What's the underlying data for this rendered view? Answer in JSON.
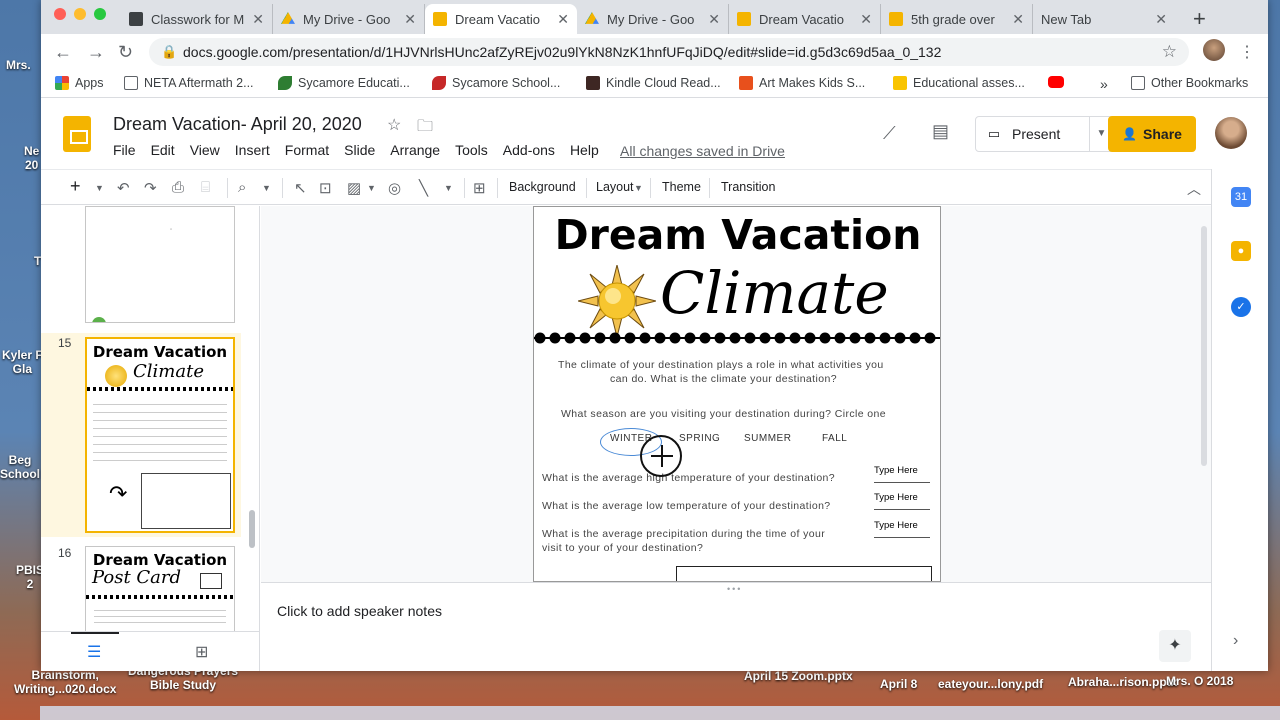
{
  "desktop": {
    "labels": [
      "Mrs.",
      "Ne\n20",
      "T",
      "Kyler F\nGla",
      "Beg\nSchool",
      "PBIS\n2",
      "Brainstorm,\nWriting...020.docx",
      "Dangerous Prayers\nBible Study",
      "April 15 Zoom.pptx",
      "April 8",
      "eateyour...lony.pdf",
      "Abraha...rison.pptx",
      "Mrs. O 2018"
    ]
  },
  "browser": {
    "tabs": [
      {
        "label": "Classwork for M",
        "favicon": "classroom-icon",
        "color": "#3c4043"
      },
      {
        "label": "My Drive - Goo",
        "favicon": "drive-icon",
        "color": "#1a73e8"
      },
      {
        "label": "Dream Vacatio",
        "favicon": "slides-icon",
        "color": "#f4b400"
      },
      {
        "label": "My Drive - Goo",
        "favicon": "drive-icon",
        "color": "#1a73e8"
      },
      {
        "label": "Dream Vacatio",
        "favicon": "slides-icon",
        "color": "#f4b400"
      },
      {
        "label": "5th grade over",
        "favicon": "slides-icon",
        "color": "#f4b400"
      },
      {
        "label": "New Tab",
        "favicon": "",
        "color": ""
      }
    ],
    "url": "docs.google.com/presentation/d/1HJVNrlsHUnc2afZyREjv02u9lYkN8NzK1hnfUFqJiDQ/edit#slide=id.g5d3c69d5aa_0_132",
    "bookmarks": [
      {
        "label": "Apps",
        "color": "#ea4335"
      },
      {
        "label": "NETA Aftermath 2...",
        "color": "#5f6368"
      },
      {
        "label": "Sycamore Educati...",
        "color": "#2e7d32"
      },
      {
        "label": "Sycamore School...",
        "color": "#c62828"
      },
      {
        "label": "Kindle Cloud Read...",
        "color": "#3e2723"
      },
      {
        "label": "Art Makes Kids S...",
        "color": "#e8501c"
      },
      {
        "label": "Educational asses...",
        "color": "#1a1a1a"
      },
      {
        "label": "",
        "color": "#ff0000"
      },
      {
        "label": "Other Bookmarks",
        "color": "#5f6368"
      }
    ]
  },
  "slides": {
    "doc_title": "Dream Vacation- April 20, 2020",
    "menu": [
      "File",
      "Edit",
      "View",
      "Insert",
      "Format",
      "Slide",
      "Arrange",
      "Tools",
      "Add-ons",
      "Help"
    ],
    "saved_status": "All changes saved in Drive",
    "present_label": "Present",
    "share_label": "Share",
    "toolbar": {
      "background": "Background",
      "layout": "Layout",
      "theme": "Theme",
      "transition": "Transition"
    },
    "filmstrip": {
      "slide_numbers": [
        "15",
        "16"
      ],
      "selected_slide": "15"
    },
    "notes_placeholder": "Click to add speaker notes"
  },
  "slide": {
    "title": "Dream Vacation",
    "subtitle": "Climate",
    "intro": [
      "The climate of your destination plays a role in what activities you",
      "can do.  What is the climate your destination?"
    ],
    "season_question": "What season are you visiting your destination during? Circle one",
    "seasons": [
      "WINTER",
      "SPRING",
      "SUMMER",
      "FALL"
    ],
    "circled_season": "WINTER",
    "questions": [
      "What is the average high temperature of your destination?",
      "What is the average low temperature of your destination?",
      "What is the average precipitation during the time of your",
      "visit to your of your destination?"
    ],
    "answer_placeholder": "Type Here"
  },
  "thumb15": {
    "title": "Dream Vacation",
    "subtitle": "Climate"
  },
  "thumb16": {
    "title": "Dream Vacation",
    "subtitle": "Post Card"
  }
}
